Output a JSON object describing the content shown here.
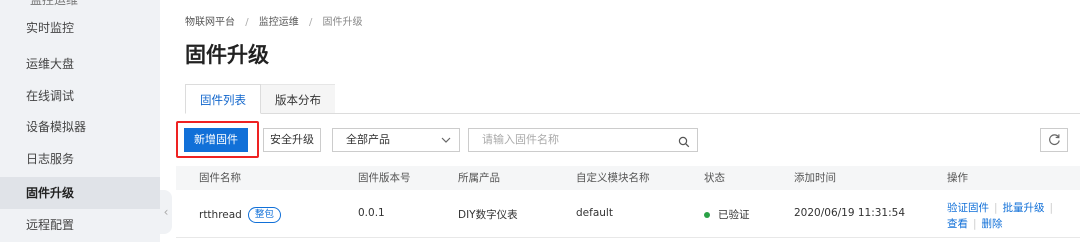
{
  "sidebar": {
    "cut_item": "监控运维",
    "items": [
      {
        "label": "实时监控"
      },
      {
        "label": "运维大盘"
      },
      {
        "label": "在线调试"
      },
      {
        "label": "设备模拟器"
      },
      {
        "label": "日志服务"
      },
      {
        "label": "固件升级"
      },
      {
        "label": "远程配置"
      }
    ],
    "active": "固件升级"
  },
  "breadcrumb": [
    "物联网平台",
    "监控运维",
    "固件升级"
  ],
  "page_title": "固件升级",
  "tabs": [
    {
      "label": "固件列表",
      "active": true
    },
    {
      "label": "版本分布",
      "active": false
    }
  ],
  "toolbar": {
    "add_label": "新增固件",
    "safe_upgrade_label": "安全升级",
    "product_select": "全部产品",
    "search_placeholder": "请输入固件名称"
  },
  "table": {
    "columns": [
      "固件名称",
      "固件版本号",
      "所属产品",
      "自定义模块名称",
      "状态",
      "添加时间",
      "操作"
    ],
    "rows": [
      {
        "name": "rtthread",
        "badge": "整包",
        "version": "0.0.1",
        "product": "DIY数字仪表",
        "module": "default",
        "status": "已验证",
        "time": "2020/06/19 11:31:54",
        "actions": [
          "验证固件",
          "批量升级",
          "查看",
          "删除"
        ]
      }
    ]
  },
  "colors": {
    "accent": "#1170d8",
    "highlight": "#e22222",
    "status_ok": "#2aa146"
  },
  "icons": {
    "search": "search-icon",
    "refresh": "refresh-icon",
    "collapse": "chevron-left-icon",
    "dropdown": "chevron-down-icon"
  }
}
